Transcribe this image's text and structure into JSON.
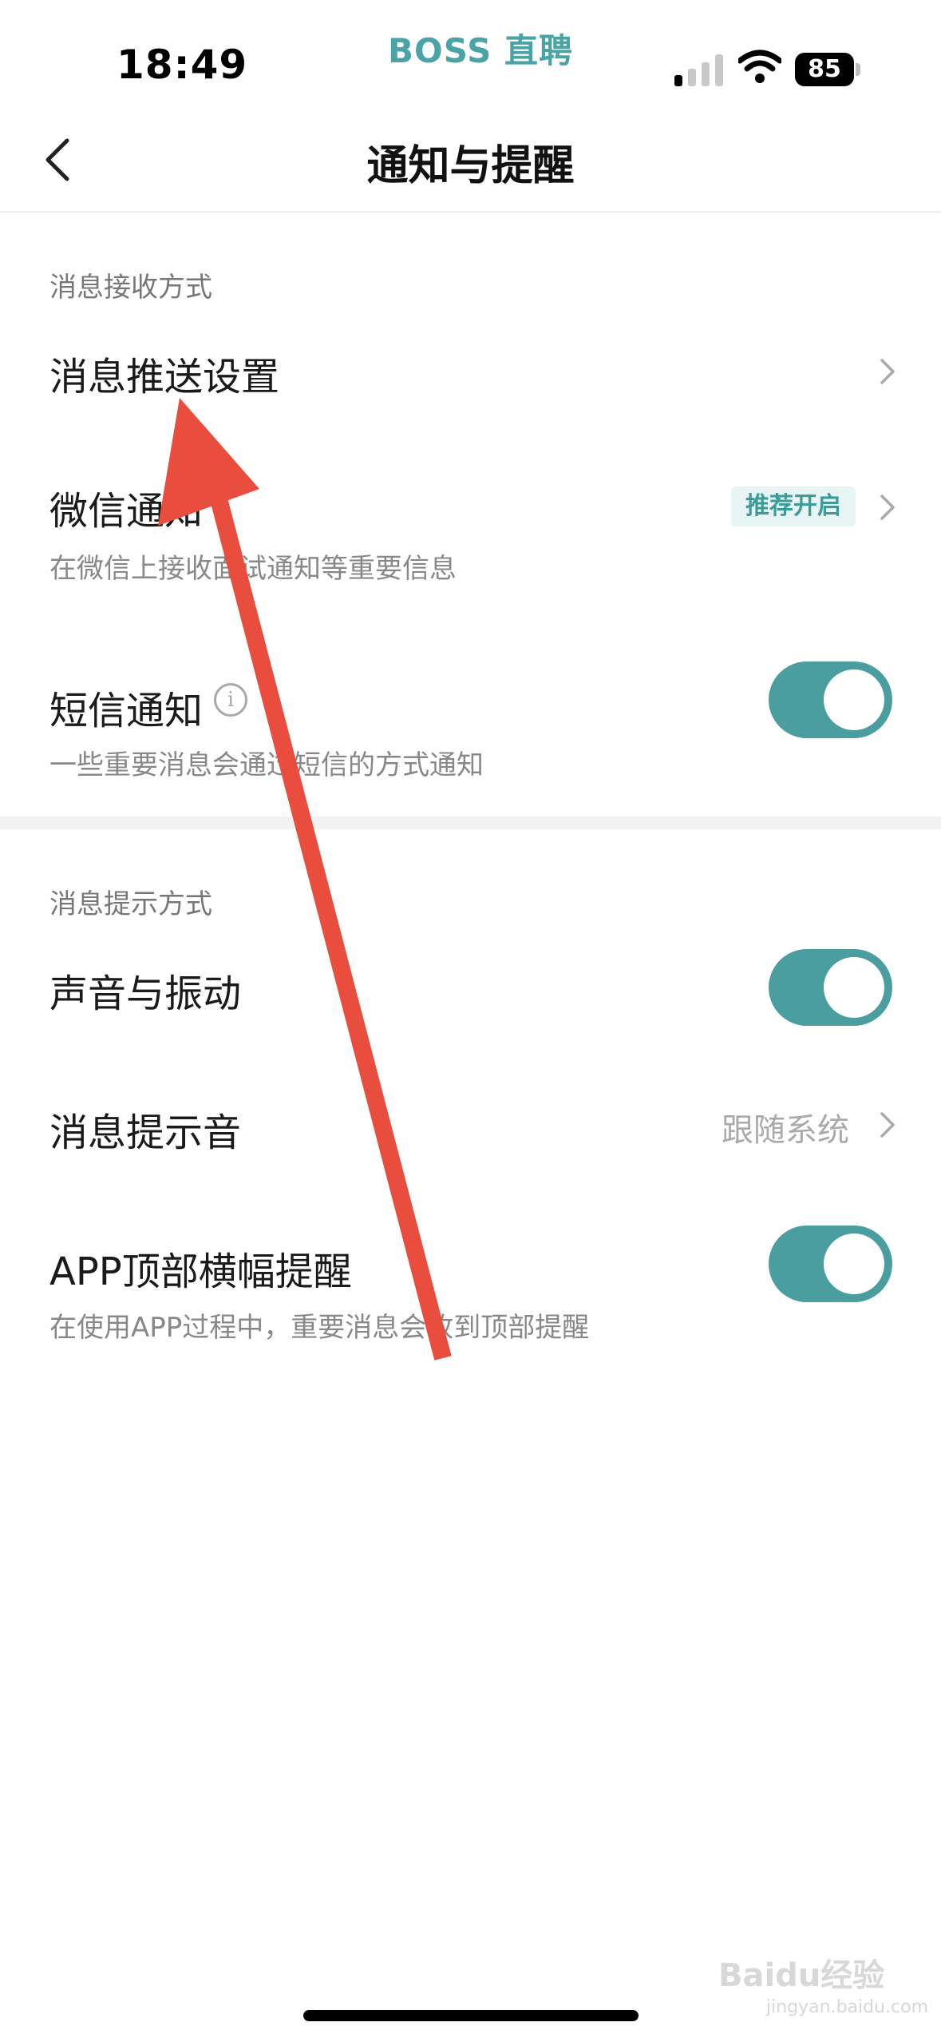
{
  "status_bar": {
    "time": "18:49",
    "carrier_brand": "BOSS 直聘",
    "battery": "85"
  },
  "nav": {
    "title": "通知与提醒"
  },
  "section_receive": {
    "label": "消息接收方式",
    "push_settings": {
      "title": "消息推送设置"
    },
    "wechat": {
      "title": "微信通知",
      "subtitle": "在微信上接收面试通知等重要信息",
      "badge": "推荐开启"
    },
    "sms": {
      "title": "短信通知",
      "subtitle": "一些重要消息会通过短信的方式通知",
      "enabled": true
    }
  },
  "section_alert": {
    "label": "消息提示方式",
    "sound_vibration": {
      "title": "声音与振动",
      "enabled": true
    },
    "alert_tone": {
      "title": "消息提示音",
      "value": "跟随系统"
    },
    "top_banner": {
      "title": "APP顶部横幅提醒",
      "subtitle": "在使用APP过程中，重要消息会收到顶部提醒",
      "enabled": true
    }
  },
  "watermark": {
    "text": "Baidu经验",
    "sub": "jingyan.baidu.com"
  },
  "colors": {
    "accent": "#4a9ea0",
    "annotation_arrow": "#e84d3d"
  }
}
